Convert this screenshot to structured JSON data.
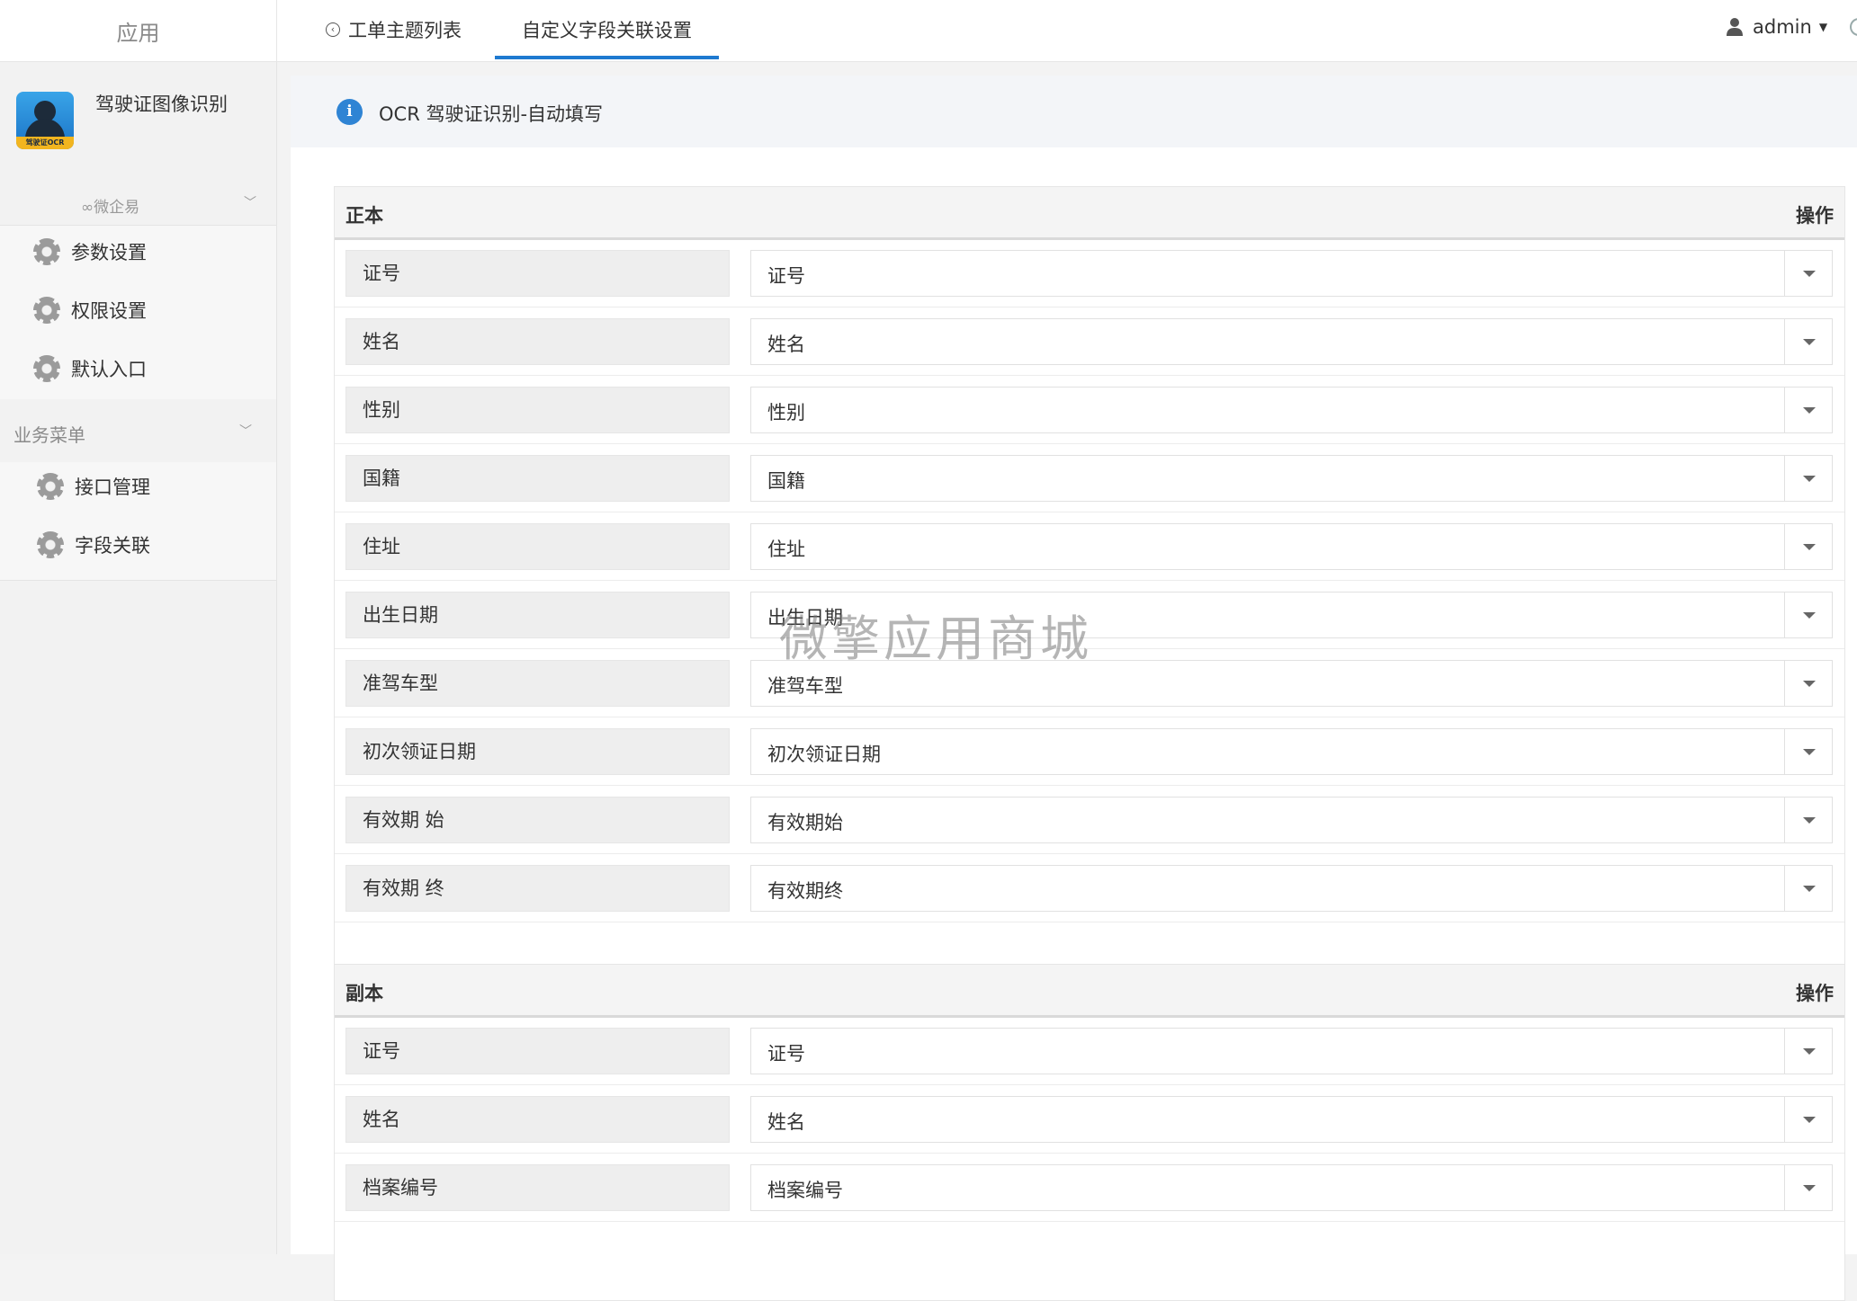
{
  "topbar": {
    "brand": "应用",
    "back_tab_label": "工单主题列表",
    "active_tab_label": "自定义字段关联设置",
    "user_name": "admin"
  },
  "sidebar": {
    "app_name": "驾驶证图像识别",
    "app_logo_text": "驾驶证OCR",
    "wechat_label": "微企易",
    "settings_items": [
      "参数设置",
      "权限设置",
      "默认入口"
    ],
    "section_title": "业务菜单",
    "business_items": [
      "接口管理",
      "字段关联"
    ]
  },
  "notice": {
    "text": "OCR 驾驶证识别-自动填写"
  },
  "front_panel": {
    "title": "正本",
    "action_header": "操作",
    "rows": [
      {
        "name": "证号",
        "value": "证号"
      },
      {
        "name": "姓名",
        "value": "姓名"
      },
      {
        "name": "性别",
        "value": "性别"
      },
      {
        "name": "国籍",
        "value": "国籍"
      },
      {
        "name": "住址",
        "value": "住址"
      },
      {
        "name": "出生日期",
        "value": "出生日期"
      },
      {
        "name": "准驾车型",
        "value": "准驾车型"
      },
      {
        "name": "初次领证日期",
        "value": "初次领证日期"
      },
      {
        "name": "有效期 始",
        "value": "有效期始"
      },
      {
        "name": "有效期 终",
        "value": "有效期终"
      }
    ]
  },
  "back_panel": {
    "title": "副本",
    "action_header": "操作",
    "rows": [
      {
        "name": "证号",
        "value": "证号"
      },
      {
        "name": "姓名",
        "value": "姓名"
      },
      {
        "name": "档案编号",
        "value": "档案编号"
      }
    ]
  },
  "watermark": "微擎应用商城"
}
